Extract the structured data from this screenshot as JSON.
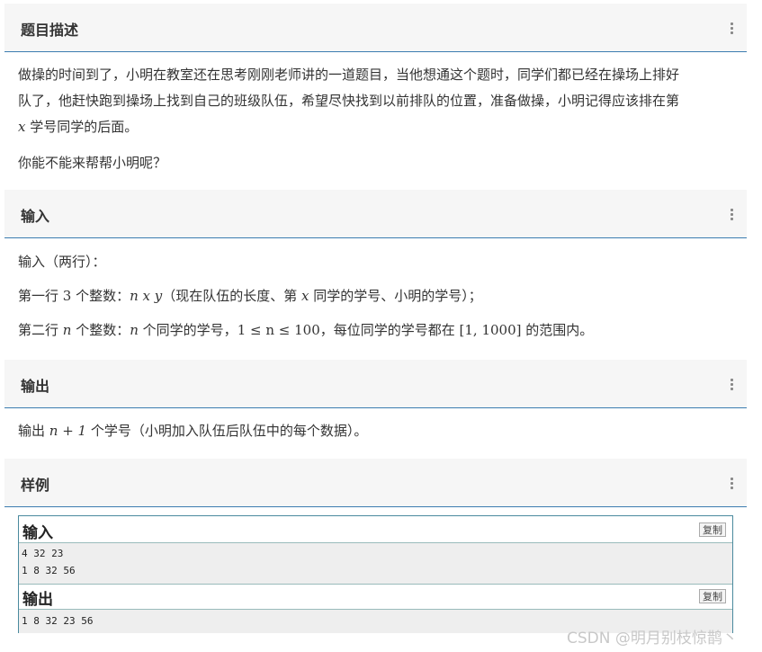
{
  "sections": {
    "description": {
      "title": "题目描述",
      "line1": "做操的时间到了，小明在教室还在思考刚刚老师讲的一道题目，当他想通这个题时，同学们都已经在操场上排好",
      "line2": "队了，他赶快跑到操场上找到自己的班级队伍，希望尽快找到以前排队的位置，准备做操，小明记得应该排在第",
      "line3_var": "x",
      "line3_text": " 学号同学的后面。",
      "line4": "你能不能来帮帮小明呢？"
    },
    "input": {
      "title": "输入",
      "line1": "输入（两行）：",
      "line2_a": "第一行 ",
      "line2_num": "3",
      "line2_b": " 个整数：",
      "line2_vars": "n x y",
      "line2_c": "（现在队伍的长度、第 ",
      "line2_x": "x",
      "line2_d": " 同学的学号、小明的学号）；",
      "line3_a": "第二行 ",
      "line3_n": "n",
      "line3_b": " 个整数：",
      "line3_n2": "n",
      "line3_c": " 个同学的学号，",
      "line3_range": "1 ≤ n ≤ 100",
      "line3_d": "，每位同学的学号都在 ",
      "line3_interval": "[1, 1000]",
      "line3_e": " 的范围内。"
    },
    "output": {
      "title": "输出",
      "line1_a": "输出 ",
      "line1_expr": "n + 1",
      "line1_b": " 个学号（小明加入队伍后队伍中的每个数据）。"
    },
    "sample": {
      "title": "样例"
    }
  },
  "sample_box": {
    "input_label": "输入",
    "output_label": "输出",
    "copy_label": "复制",
    "input_lines": [
      "4 32 23",
      "1 8 32 56"
    ],
    "output_lines": [
      "1 8 32 23 56"
    ]
  },
  "watermark": "CSDN @明月别枝惊鹊丶",
  "icons": {
    "menu": "more-vertical-icon"
  },
  "colors": {
    "accent": "#3c7cb0",
    "header_bg": "#f6f6f6",
    "code_bg": "#eeeeee"
  }
}
